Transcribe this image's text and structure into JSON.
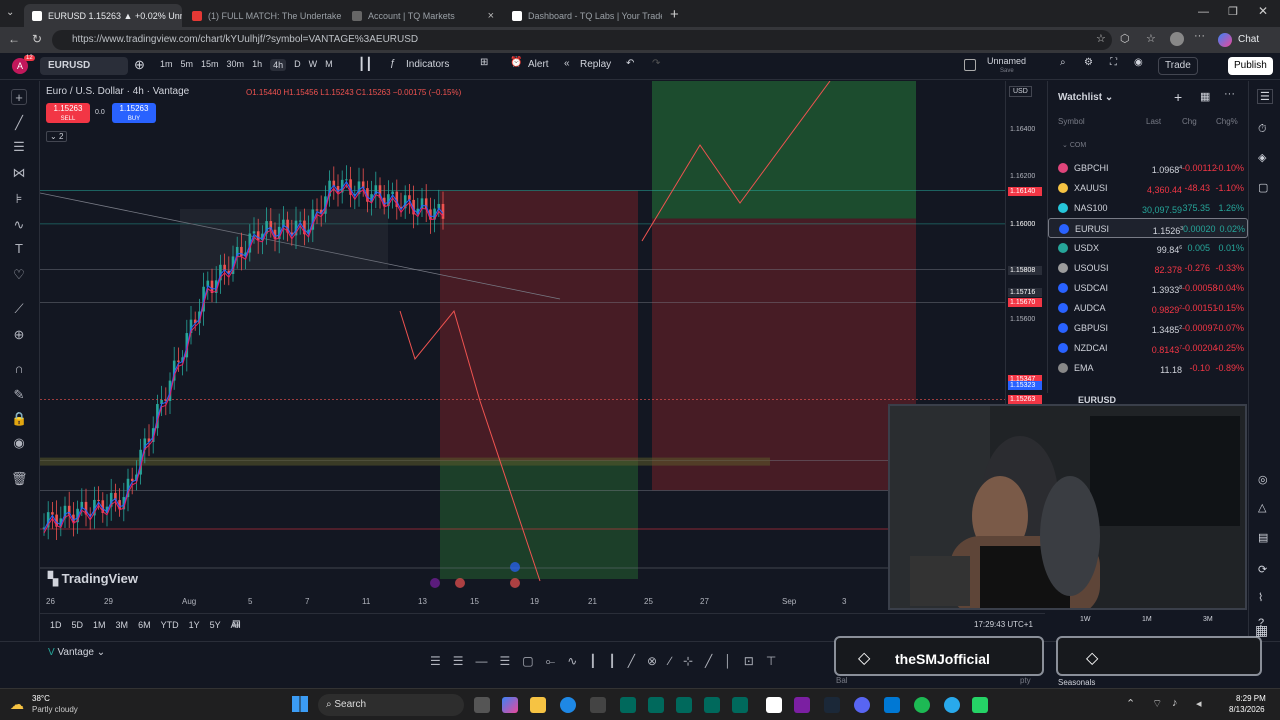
{
  "browser": {
    "tabs": [
      {
        "label": "EURUSD 1.15263 ▲ +0.02% Unnam",
        "active": true
      },
      {
        "label": "(1) FULL MATCH: The Undertaker",
        "active": false
      },
      {
        "label": "Account | TQ Markets",
        "active": false
      },
      {
        "label": "Dashboard - TQ Labs | Your Tradel",
        "active": false
      }
    ],
    "url": "https://www.tradingview.com/chart/kYUulhjf/?symbol=VANTAGE%3AEURUSD",
    "chat_label": "Chat"
  },
  "toolbar": {
    "symbol": "EURUSD",
    "intervals": [
      "1m",
      "5m",
      "15m",
      "30m",
      "1h",
      "4h",
      "D",
      "W",
      "M"
    ],
    "active_interval": "4h",
    "indicators": "Indicators",
    "alert": "Alert",
    "replay": "Replay",
    "layout_name": "Unnamed",
    "layout_sub": "Save",
    "trade": "Trade",
    "publish": "Publish",
    "avatar_letter": "A",
    "avatar_badge": "12"
  },
  "legend": {
    "title": "Euro / U.S. Dollar · 4h · Vantage",
    "ohlc": "O1.15440 H1.15456 L1.15243 C1.15263 −0.00175 (−0.15%)",
    "sell_price": "1.15263",
    "sell_label": "SELL",
    "spread": "0.0",
    "buy_price": "1.15263",
    "buy_label": "BUY",
    "indicator_count": "2"
  },
  "price_axis": {
    "currency": "USD",
    "labels": [
      "1.16400",
      "1.16200",
      "1.16140",
      "1.16000",
      "1.15808",
      "1.15716",
      "1.15670",
      "1.15600",
      "1.15347",
      "1.15323",
      "1.15263",
      "30:17",
      "1.15006",
      "1.14881",
      "1.14800",
      "1.14600",
      "1.14555"
    ]
  },
  "time_axis": {
    "labels": [
      "26",
      "29",
      "Aug",
      "5",
      "7",
      "11",
      "13",
      "15",
      "19",
      "21",
      "25",
      "27",
      "Sep",
      "3"
    ]
  },
  "watermark": "TradingView",
  "ranges": {
    "items": [
      "1D",
      "5D",
      "1M",
      "3M",
      "6M",
      "YTD",
      "1Y",
      "5Y",
      "All"
    ],
    "clock": "17:29:43 UTC+1"
  },
  "watchlist": {
    "title": "Watchlist",
    "headers": [
      "Symbol",
      "Last",
      "Chg",
      "Chg%"
    ],
    "section": "COM",
    "rows": [
      {
        "symbol": "GBPCHI",
        "last": "1.0968",
        "lastsup": "4",
        "chg": "-0.00112",
        "pct": "-0.10%",
        "up": false,
        "color": "#e0457b"
      },
      {
        "symbol": "XAUUSI",
        "last": "4,360.44",
        "lastsup": "",
        "chg": "-48.43",
        "pct": "-1.10%",
        "up": false,
        "color": "#f6c343"
      },
      {
        "symbol": "NAS100",
        "last": "30,097.59",
        "lastsup": "",
        "chg": "375.35",
        "pct": "1.26%",
        "up": true,
        "color": "#26c6da"
      },
      {
        "symbol": "EURUSI",
        "last": "1.1526",
        "lastsup": "3",
        "chg": "0.00020",
        "pct": "0.02%",
        "up": true,
        "color": "#2962ff"
      },
      {
        "symbol": "USDX",
        "last": "99.84",
        "lastsup": "6",
        "chg": "0.005",
        "pct": "0.01%",
        "up": true,
        "color": "#26a69a"
      },
      {
        "symbol": "USOUSI",
        "last": "82.378",
        "lastsup": "",
        "chg": "-0.276",
        "pct": "-0.33%",
        "up": false,
        "color": "#9c9c9c"
      },
      {
        "symbol": "USDCAI",
        "last": "1.3933",
        "lastsup": "8",
        "chg": "-0.00058",
        "pct": "-0.04%",
        "up": false,
        "color": "#2962ff"
      },
      {
        "symbol": "AUDCA",
        "last": "0.9829",
        "lastsup": "2",
        "chg": "-0.00151",
        "pct": "-0.15%",
        "up": false,
        "color": "#2962ff"
      },
      {
        "symbol": "GBPUSI",
        "last": "1.3485",
        "lastsup": "2",
        "chg": "-0.00097",
        "pct": "-0.07%",
        "up": false,
        "color": "#2962ff"
      },
      {
        "symbol": "NZDCAI",
        "last": "0.8143",
        "lastsup": "7",
        "chg": "-0.00204",
        "pct": "-0.25%",
        "up": false,
        "color": "#2962ff"
      },
      {
        "symbol": "EMA",
        "last": "11.18",
        "lastsup": "",
        "chg": "-0.10",
        "pct": "-0.89%",
        "up": false,
        "color": "#888"
      }
    ],
    "details_symbol": "EURUSD"
  },
  "bottom": {
    "broker": "Vantage",
    "stream_name": "theSMJofficial",
    "right_labels": [
      "1W",
      "1M",
      "3M"
    ],
    "sub_label": "Seasonals",
    "b_labels": [
      "Bal",
      "pty"
    ]
  },
  "taskbar": {
    "temp": "38°C",
    "weather": "Partly cloudy",
    "search": "Search",
    "time": "8:29 PM",
    "date": "8/13/2026"
  },
  "colors": {
    "bg": "#131722",
    "green_zone": "#1f5a32",
    "red_zone": "#5a1f27",
    "accent": "#2962ff",
    "up": "#26a69a",
    "down": "#ef5350"
  },
  "chart_data": {
    "type": "candlestick",
    "symbol": "EURUSD",
    "interval": "4h",
    "ylim": [
      1.1445,
      1.166
    ],
    "last_price": 1.15263,
    "levels": [
      1.1614,
      1.16,
      1.15808,
      1.1567,
      1.15006,
      1.14881,
      1.14555
    ],
    "position_long": {
      "entry": 1.15006,
      "target": 1.1614,
      "stop": 1.14881
    },
    "position_short": {
      "entry": 1.1567,
      "target": 1.14555,
      "stop": 1.1614
    }
  }
}
